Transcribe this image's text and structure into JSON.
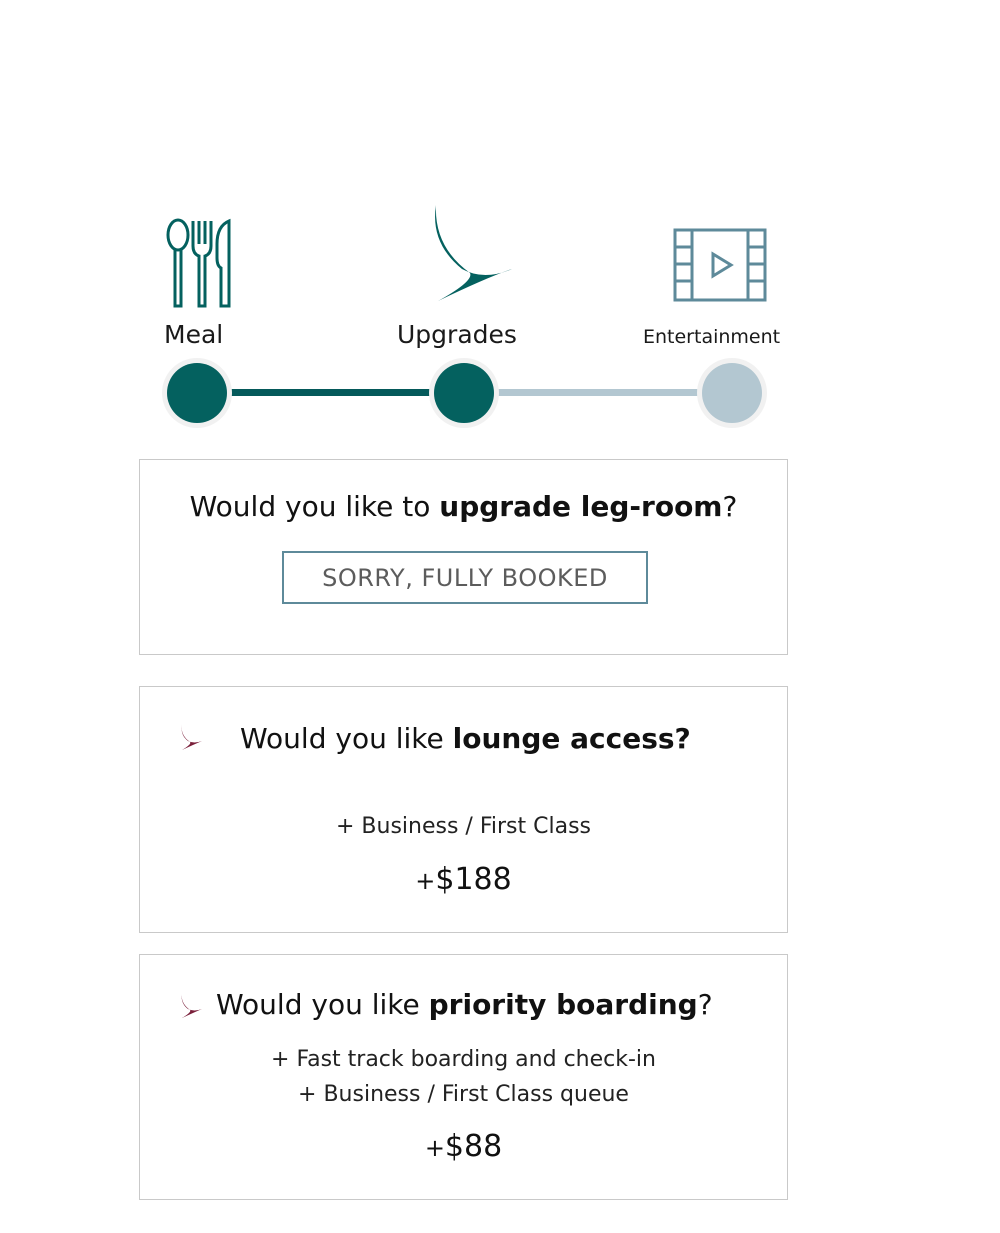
{
  "progress": {
    "steps": [
      {
        "label": "Meal",
        "icon": "cutlery-icon",
        "status": "completed"
      },
      {
        "label": "Upgrades",
        "icon": "brand-wing-logo",
        "status": "current"
      },
      {
        "label": "Entertainment",
        "icon": "film-play-icon",
        "status": "upcoming"
      }
    ],
    "completed_fraction": 0.5
  },
  "colors": {
    "accent": "#04615f",
    "inactive": "#b3c7d1",
    "icon_blue": "#5e8a9a",
    "brand_burgundy": "#7a1f3a",
    "card_border": "#c9c9c9"
  },
  "cards": {
    "legroom": {
      "question_prefix": "Would you like to ",
      "question_bold": "upgrade leg-room",
      "question_suffix": "?",
      "button_label": "SORRY, FULLY BOOKED"
    },
    "lounge": {
      "question_prefix": "Would you like ",
      "question_bold": "lounge access?",
      "question_suffix": "",
      "features": [
        "+ Business / First Class"
      ],
      "price_plus": "+",
      "price": "$188"
    },
    "priority": {
      "question_prefix": "Would you like ",
      "question_bold": "priority boarding",
      "question_suffix": "?",
      "features": [
        "+ Fast track boarding and check-in",
        "+ Business / First Class queue"
      ],
      "price_plus": "+",
      "price": "$88"
    }
  }
}
